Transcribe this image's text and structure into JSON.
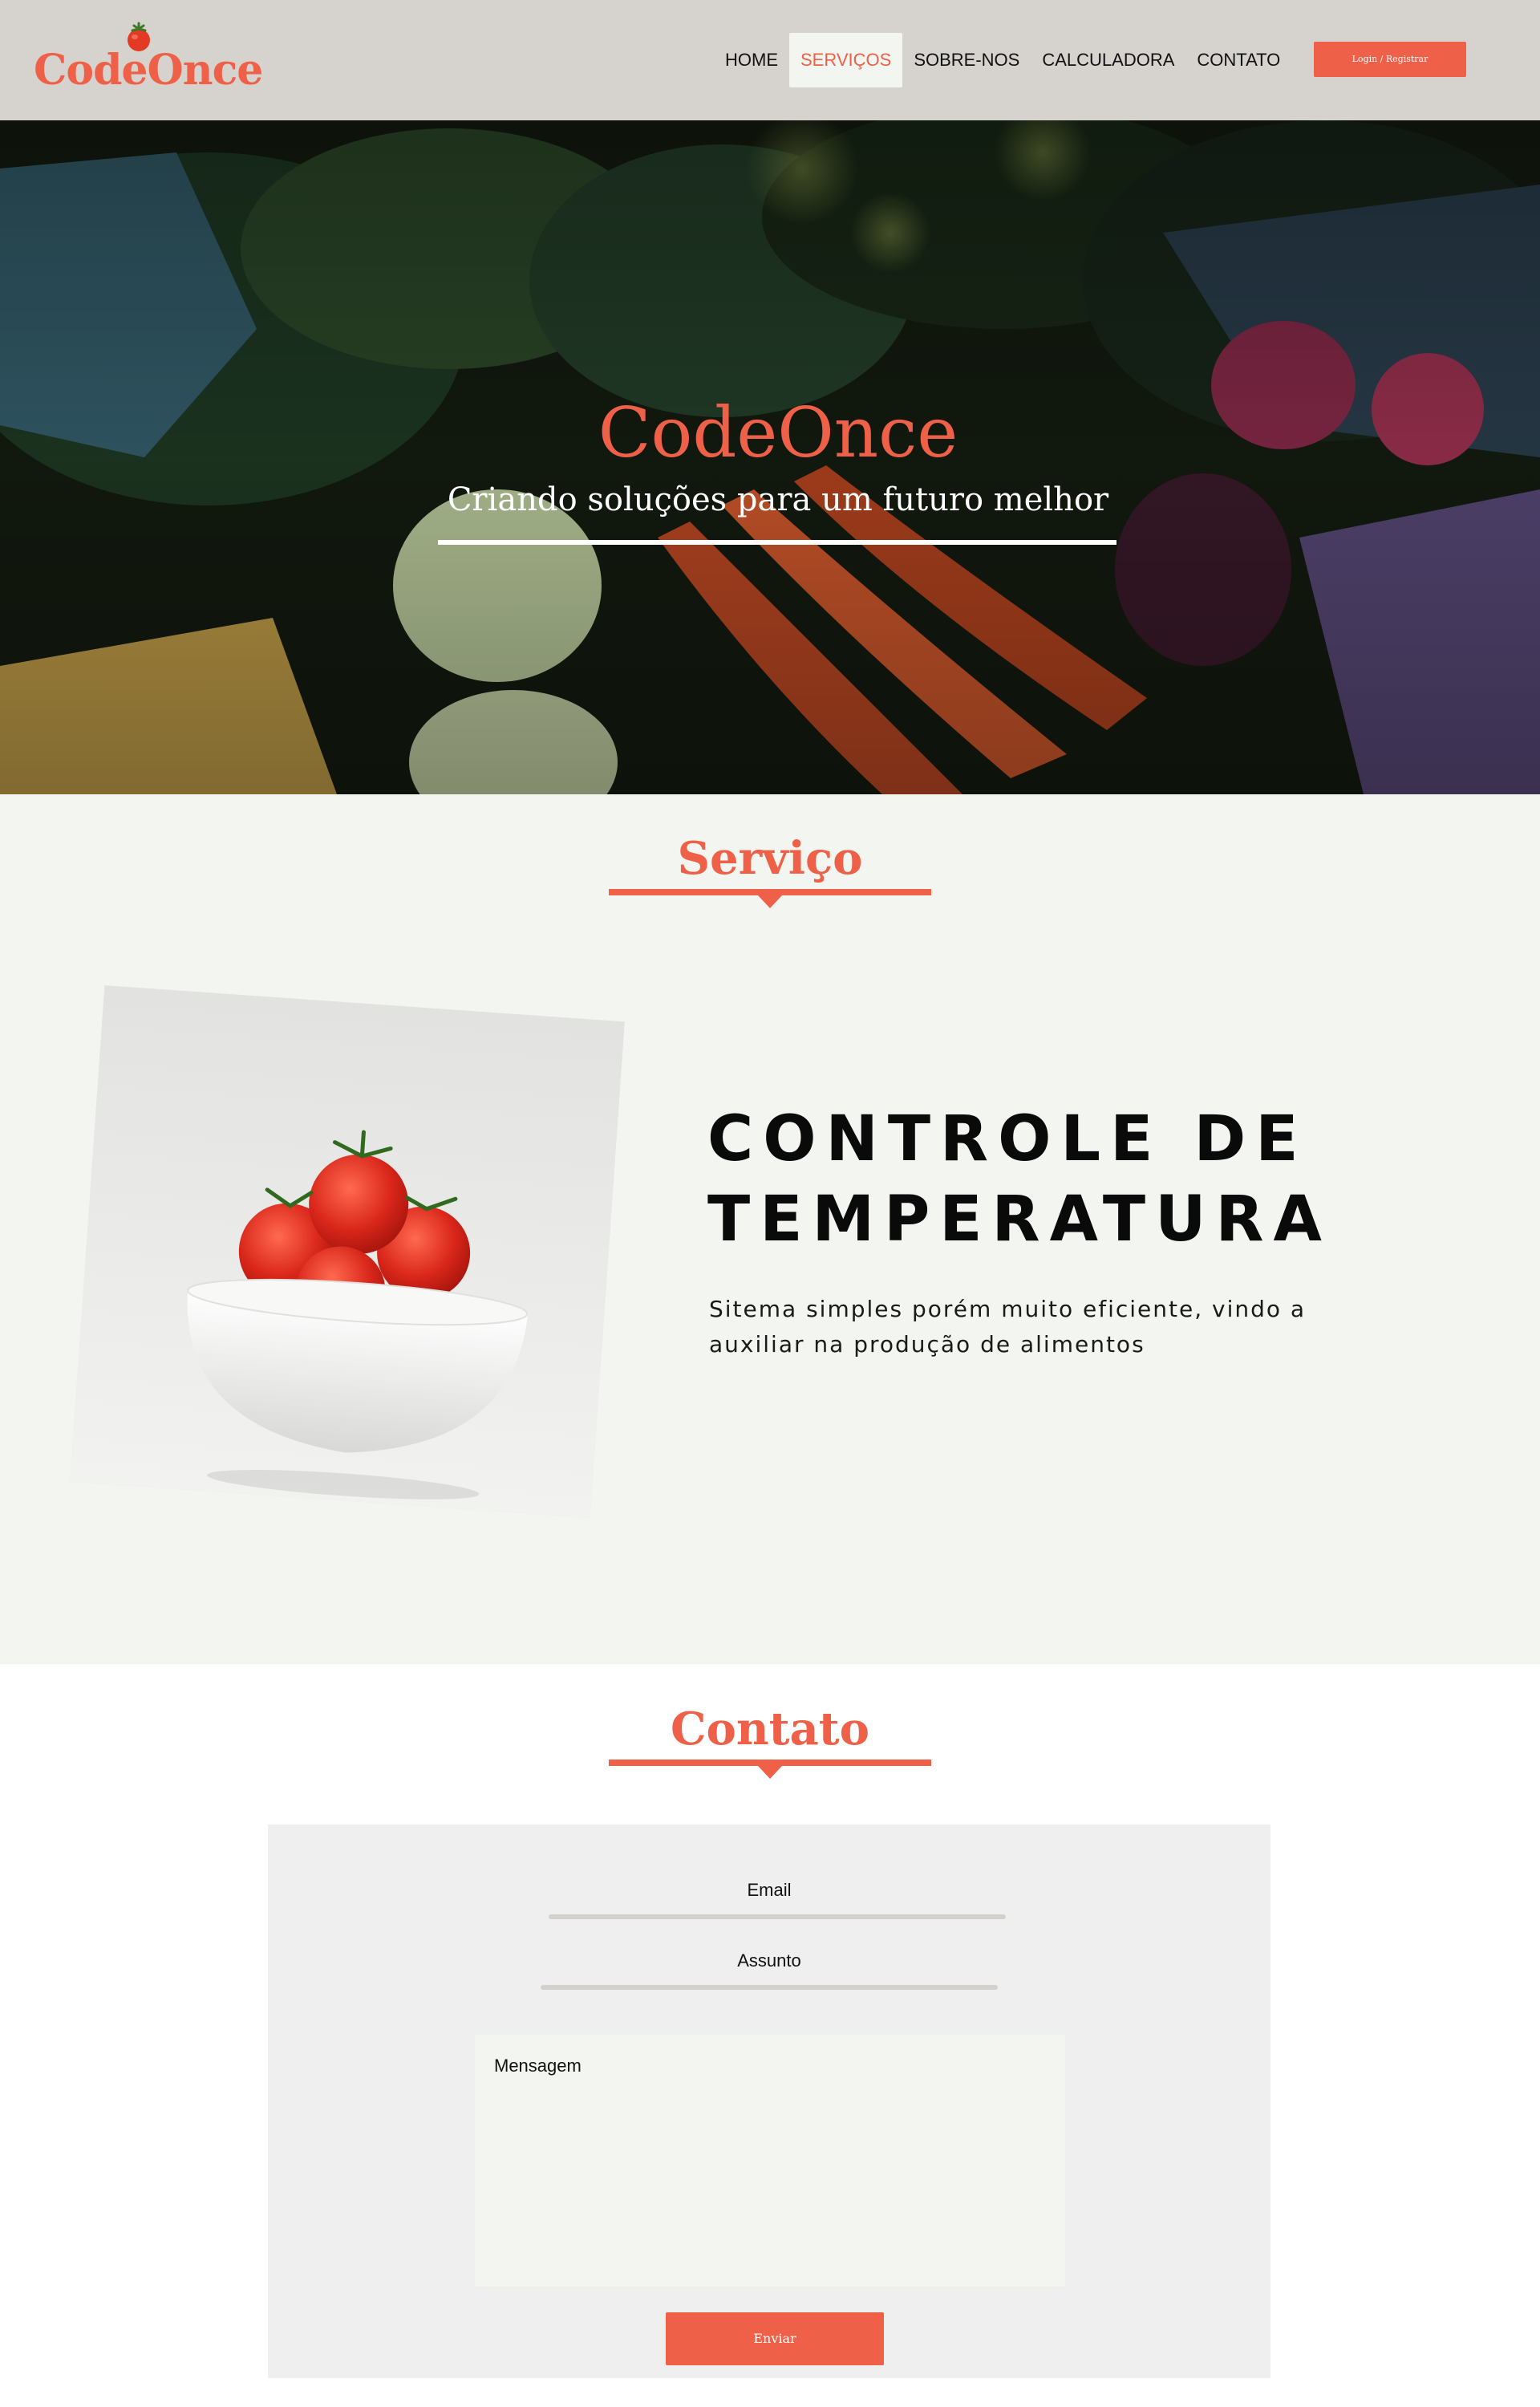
{
  "header": {
    "logo": "CodeOnce",
    "nav": [
      {
        "label": "HOME",
        "active": false
      },
      {
        "label": "SERVIÇOS",
        "active": true
      },
      {
        "label": "SOBRE-NOS",
        "active": false
      },
      {
        "label": "CALCULADORA",
        "active": false
      },
      {
        "label": "CONTATO",
        "active": false
      }
    ],
    "login_label": "Login / Registrar"
  },
  "hero": {
    "title": "CodeOnce",
    "subtitle": "Criando soluções para um futuro melhor"
  },
  "service": {
    "section_title": "Serviço",
    "heading": "CONTROLE DE TEMPERATURA",
    "description": "Sitema simples porém muito eficiente, vindo a auxiliar na produção de alimentos"
  },
  "contact": {
    "section_title": "Contato",
    "email_label": "Email",
    "subject_label": "Assunto",
    "message_placeholder": "Mensagem",
    "send_label": "Enviar"
  },
  "colors": {
    "accent": "#ee6048",
    "header_bg": "#d6d2cd",
    "section_bg": "#f3f6f0",
    "form_bg": "#efeff0"
  },
  "icons": {
    "logo_mark": "tomato-icon"
  }
}
